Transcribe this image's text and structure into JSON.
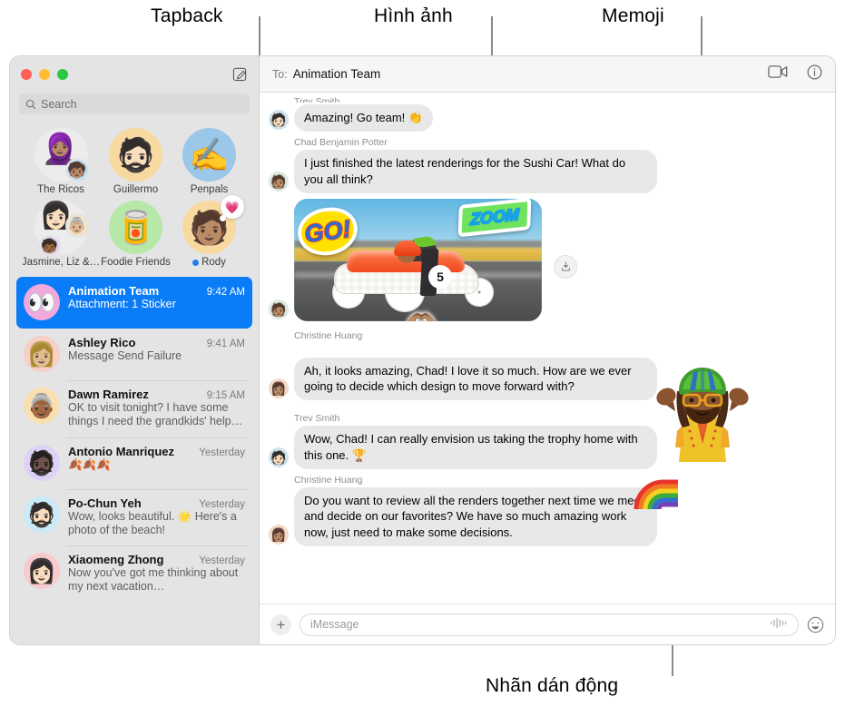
{
  "callouts": [
    {
      "id": "tapback",
      "label": "Tapback"
    },
    {
      "id": "image",
      "label": "Hình ảnh"
    },
    {
      "id": "memoji",
      "label": "Memoji"
    },
    {
      "id": "sticker",
      "label": "Nhãn dán động"
    }
  ],
  "window": {
    "traffic_lights": [
      "close",
      "minimize",
      "zoom"
    ],
    "compose_label": "compose-new-message"
  },
  "sidebar": {
    "search": {
      "placeholder": "Search",
      "icon": "search-icon"
    },
    "pinned": [
      {
        "name": "The Ricos",
        "emoji": "🧕🏽",
        "bg": "#ececec",
        "mini": "🧒🏽",
        "mini_bg": "#bfe0f5",
        "badge": null
      },
      {
        "name": "Guillermo",
        "emoji": "🧔🏻",
        "bg": "#f8d9a0",
        "mini": null,
        "mini_bg": null,
        "badge": null
      },
      {
        "name": "Penpals",
        "emoji": "✍️",
        "bg": "#9bc8e8",
        "mini": null,
        "mini_bg": null,
        "badge": null
      },
      {
        "name": "Jasmine, Liz &…",
        "emoji": "👩🏻",
        "bg": "#ececec",
        "mini": "👵🏼",
        "mini_bg": "#f2e3c9",
        "badge": null
      },
      {
        "name": "Foodie Friends",
        "emoji": "🥫",
        "bg": "#b7e8a8",
        "mini": null,
        "mini_bg": null,
        "badge": null
      },
      {
        "name": "Rody",
        "emoji": "🧑🏽",
        "bg": "#f8d9a0",
        "mini": null,
        "mini_bg": null,
        "badge": "💗",
        "online": true
      }
    ],
    "conversations": [
      {
        "name": "Animation Team",
        "time": "9:42 AM",
        "preview": "Attachment: 1 Sticker",
        "avatar": "👀",
        "avatar_bg": "#f0a8dd",
        "selected": true
      },
      {
        "name": "Ashley Rico",
        "time": "9:41 AM",
        "preview": "Message Send Failure",
        "avatar": "👩🏼",
        "avatar_bg": "#f7cfc6",
        "selected": false
      },
      {
        "name": "Dawn Ramirez",
        "time": "9:15 AM",
        "preview": "OK to visit tonight? I have some things I need the grandkids' help with. 🥰",
        "avatar": "👵🏾",
        "avatar_bg": "#fae0b0",
        "selected": false
      },
      {
        "name": "Antonio Manriquez",
        "time": "Yesterday",
        "preview": "🍂🍂🍂",
        "avatar": "🧔🏿",
        "avatar_bg": "#ddd2f5",
        "selected": false
      },
      {
        "name": "Po-Chun Yeh",
        "time": "Yesterday",
        "preview": "Wow, looks beautiful. 🌟 Here's a photo of the beach!",
        "avatar": "🧔🏻",
        "avatar_bg": "#c9eaf7",
        "selected": false
      },
      {
        "name": "Xiaomeng Zhong",
        "time": "Yesterday",
        "preview": "Now you've got me thinking about my next vacation…",
        "avatar": "👩🏻",
        "avatar_bg": "#f8c9cd",
        "selected": false
      }
    ]
  },
  "main": {
    "to_label": "To:",
    "to_value": "Animation Team",
    "facetime_icon": "video-camera-icon",
    "info_icon": "info-circle-icon",
    "messages": [
      {
        "sender": "Trev Smith",
        "type": "text",
        "text": "Amazing! Go team! 👏",
        "avatar": "🧑🏻",
        "avatar_bg": "#cfe3ef",
        "sender_clipped": true
      },
      {
        "sender": "Chad Benjamin Potter",
        "type": "text",
        "text": "I just finished the latest renderings for the Sushi Car! What do you all think?",
        "avatar": "🧑🏽",
        "avatar_bg": "#d9e9df"
      },
      {
        "sender": "",
        "type": "photo",
        "avatar": "🧑🏽",
        "avatar_bg": "#d9e9df",
        "photo": {
          "alt": "sushi-soapbox-race-car",
          "car_number": "5",
          "stickers": [
            {
              "name": "go-sticker",
              "text": "GO!"
            },
            {
              "name": "zoom-sticker",
              "text": "ZOOM"
            },
            {
              "name": "heart-hands-sticker",
              "glyph": "🫶🏽"
            }
          ],
          "save_icon": "save-download-icon"
        }
      },
      {
        "sender": "Christine Huang",
        "type": "text",
        "text": "Ah, it looks amazing, Chad! I love it so much. How are we ever going to decide which design to move forward with?",
        "avatar": "👩🏽",
        "avatar_bg": "#f3d9c8"
      },
      {
        "sender": "Trev Smith",
        "type": "text",
        "text": "Wow, Chad! I can really envision us taking the trophy home with this one. 🏆",
        "avatar": "🧑🏻",
        "avatar_bg": "#cfe3ef"
      },
      {
        "sender": "Christine Huang",
        "type": "text",
        "text": "Do you want to review all the renders together next time we meet and decide on our favorites? We have so much amazing work now, just need to make some decisions.",
        "avatar": "👩🏽",
        "avatar_bg": "#f3d9c8"
      }
    ],
    "floating": {
      "memoji": {
        "name": "shrugging-memoji",
        "glyph": "🤷🏿‍♂️"
      },
      "rainbow_sticker": {
        "name": "rainbow-sticker",
        "glyph": "🌈"
      }
    },
    "composer": {
      "plus_label": "+",
      "input_placeholder": "iMessage",
      "audio_icon": "audio-waveform-icon",
      "emoji_icon": "emoji-smiley-icon"
    }
  },
  "colors": {
    "accent": "#0a7cf7",
    "sidebar_bg": "#e4e4e4",
    "bubble_bg": "#e8e8e9",
    "header_bg": "#f6f6f6",
    "callout_line": "#8a8a8a"
  }
}
